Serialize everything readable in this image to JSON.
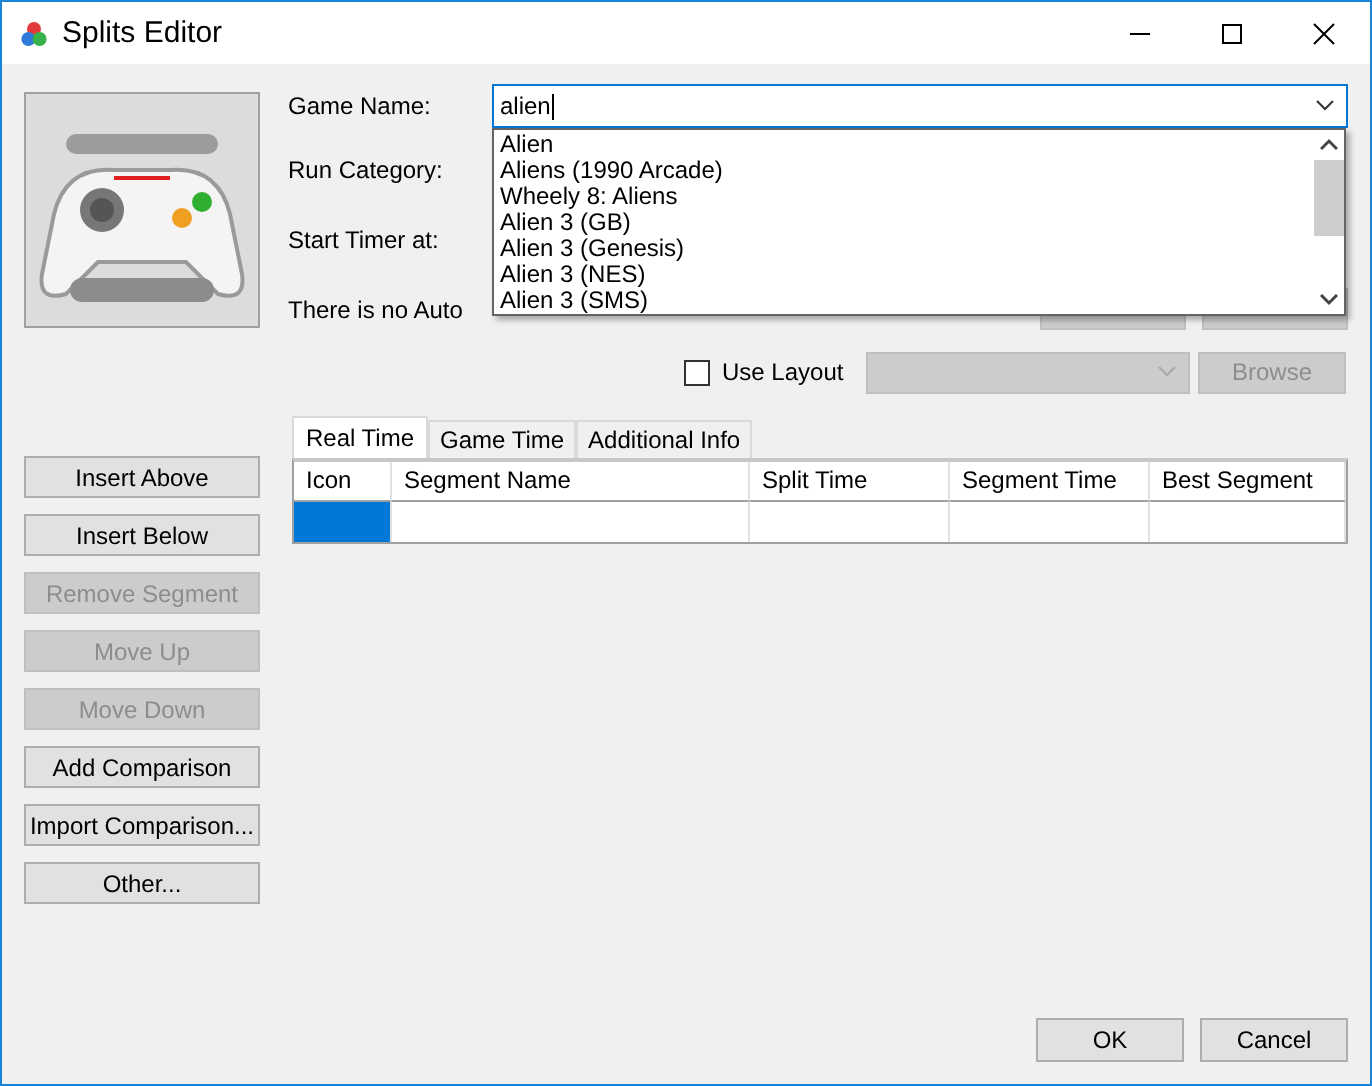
{
  "window": {
    "title": "Splits Editor"
  },
  "game_name": {
    "label": "Game Name:",
    "value": "alien",
    "expanded": true,
    "suggestions": [
      "Alien",
      "Aliens (1990 Arcade)",
      "Wheely 8: Aliens",
      "Alien 3 (GB)",
      "Alien 3 (Genesis)",
      "Alien 3 (NES)",
      "Alien 3 (SMS)"
    ]
  },
  "run_category": {
    "label": "Run Category:"
  },
  "start_timer": {
    "label": "Start Timer at:"
  },
  "auto_splitter": {
    "message": "There is no Auto",
    "buttons": [
      {
        "disabled": true
      },
      {
        "disabled": true
      }
    ]
  },
  "layout": {
    "label": "Use Layout",
    "checked": false,
    "combo_disabled": true,
    "browse": {
      "label": "Browse",
      "disabled": true
    }
  },
  "side_buttons": [
    {
      "label": "Insert Above",
      "disabled": false
    },
    {
      "label": "Insert Below",
      "disabled": false
    },
    {
      "label": "Remove Segment",
      "disabled": true
    },
    {
      "label": "Move Up",
      "disabled": true
    },
    {
      "label": "Move Down",
      "disabled": true
    },
    {
      "label": "Add Comparison",
      "disabled": false
    },
    {
      "label": "Import Comparison...",
      "disabled": false
    },
    {
      "label": "Other...",
      "disabled": false
    }
  ],
  "tabs": [
    {
      "label": "Real Time",
      "selected": true
    },
    {
      "label": "Game Time",
      "selected": false
    },
    {
      "label": "Additional Info",
      "selected": false
    }
  ],
  "table": {
    "columns": [
      "Icon",
      "Segment Name",
      "Split Time",
      "Segment Time",
      "Best Segment"
    ],
    "rows": [
      {
        "selected": true
      }
    ]
  },
  "buttons": [
    {
      "label": "OK"
    },
    {
      "label": "Cancel"
    }
  ]
}
